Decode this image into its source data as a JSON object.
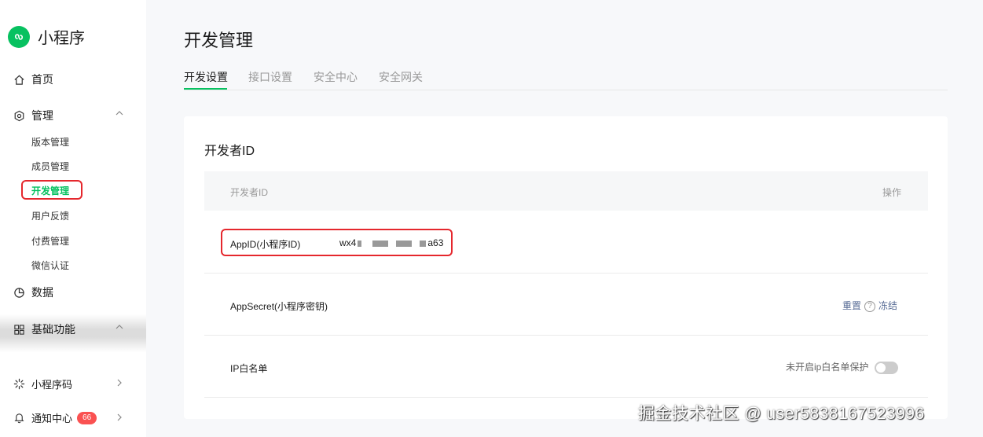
{
  "sidebar": {
    "brand": "小程序",
    "home": "首页",
    "manage": "管理",
    "manage_items": [
      "版本管理",
      "成员管理",
      "开发管理",
      "用户反馈",
      "付费管理",
      "微信认证"
    ],
    "data": "数据",
    "basic": "基础功能",
    "qrcode": "小程序码",
    "notify": "通知中心",
    "notify_count": "66"
  },
  "main": {
    "title": "开发管理",
    "tabs": [
      "开发设置",
      "接口设置",
      "安全中心",
      "安全网关"
    ],
    "card_title": "开发者ID",
    "table": {
      "col_id": "开发者ID",
      "col_action": "操作",
      "rows": {
        "appid_label": "AppID(小程序ID)",
        "appid_prefix": "wx4",
        "appid_suffix": "a63",
        "secret_label": "AppSecret(小程序密钥)",
        "secret_reset": "重置",
        "secret_freeze": "冻结",
        "ip_label": "IP白名单",
        "ip_status": "未开启ip白名单保护"
      }
    }
  },
  "watermark": "掘金技术社区 @ user5838167523996",
  "colors": {
    "accent": "#07c160",
    "highlight": "#e5272d",
    "link": "#576b95",
    "badge": "#fa5151"
  }
}
